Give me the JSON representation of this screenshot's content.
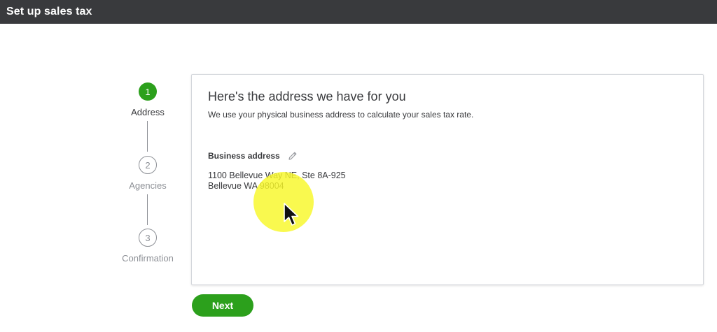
{
  "window": {
    "title": "Set up sales tax"
  },
  "stepper": {
    "steps": [
      {
        "number": "1",
        "label": "Address",
        "state": "active"
      },
      {
        "number": "2",
        "label": "Agencies",
        "state": "inactive"
      },
      {
        "number": "3",
        "label": "Confirmation",
        "state": "inactive"
      }
    ]
  },
  "card": {
    "title": "Here's the address we have for you",
    "subtitle": "We use your physical business address to calculate your sales tax rate.",
    "business_address_label": "Business address",
    "edit_icon": "pencil-icon",
    "address": {
      "line1": "1100 Bellevue Way NE, Ste 8A-925",
      "line2": "Bellevue WA 98004"
    }
  },
  "footer": {
    "next_label": "Next"
  },
  "colors": {
    "titlebar_bg": "#393a3d",
    "brand_green": "#2ca01c",
    "text": "#393a3d",
    "muted": "#8d9096",
    "card_border": "#d4d7dc",
    "cursor_highlight": "#f8f828"
  }
}
